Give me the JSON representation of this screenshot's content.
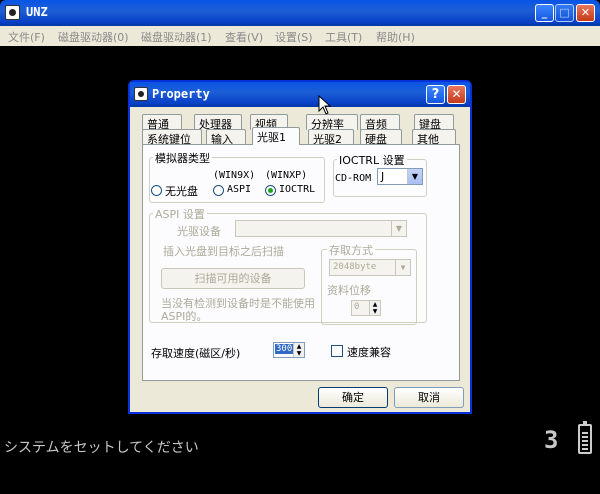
{
  "app": {
    "title": "UNZ"
  },
  "menu": [
    "文件(F)",
    "磁盘驱动器(0)",
    "磁盘驱动器(1)",
    "查看(V)",
    "设置(S)",
    "工具(T)",
    "帮助(H)"
  ],
  "status_text": "システムをセットしてください",
  "status_digit": "3",
  "dialog": {
    "title": "Property",
    "help_label": "?",
    "close_label": "✕",
    "tabs_row1": [
      "普通",
      "处理器",
      "视频",
      "分辨率",
      "音频",
      "键盘"
    ],
    "tabs_row2": [
      "系统键位",
      "输入",
      "光驱1",
      "光驱2",
      "硬盘",
      "其他"
    ],
    "active_tab": "光驱1",
    "emulator_group": {
      "label": "模拟器类型",
      "win9x_label": "(WIN9X)",
      "winxp_label": "(WINXP)",
      "options": [
        "无光盘",
        "ASPI",
        "IOCTRL"
      ],
      "selected": "IOCTRL"
    },
    "ioctrl_group": {
      "label": "IOCTRL 设置",
      "cdrom_label": "CD-ROM",
      "cdrom_value": "J"
    },
    "aspi_group": {
      "label": "ASPI 设置",
      "drive_label": "光驱设备",
      "drive_value": "",
      "scan_note": "插入光盘到目标之后扫描",
      "scan_button": "扫描可用的设备",
      "note": "当没有检测到设备时是不能使用ASPI的。"
    },
    "access_group": {
      "label": "存取方式",
      "mode_value": "2048byte",
      "bit_shift_label": "资料位移",
      "bit_shift_value": "0"
    },
    "speed_label": "存取速度(磁区/秒)",
    "speed_value": "300",
    "compat_label": "速度兼容",
    "ok_label": "确定",
    "cancel_label": "取消"
  }
}
